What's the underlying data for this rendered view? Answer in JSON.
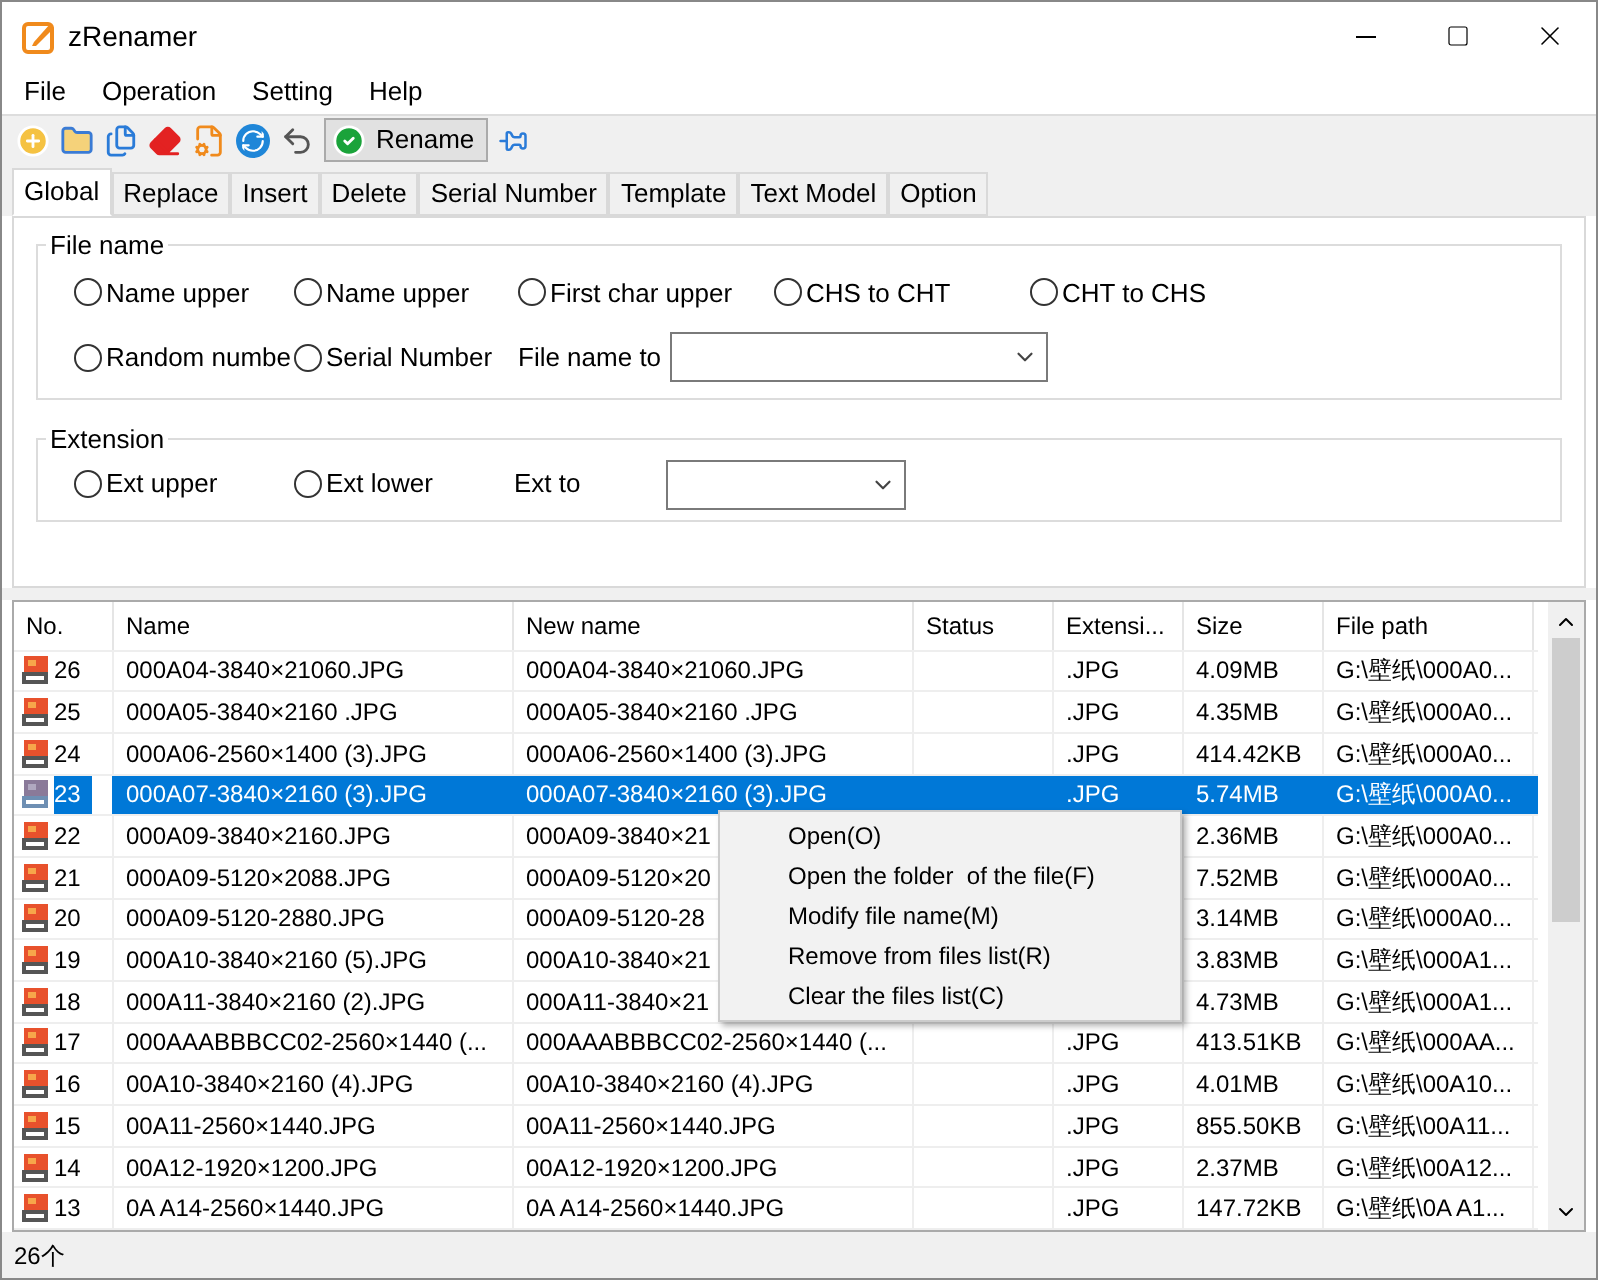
{
  "window": {
    "title": "zRenamer"
  },
  "menu": [
    "File",
    "Operation",
    "Setting",
    "Help"
  ],
  "toolbar": {
    "rename_button": "Rename"
  },
  "tabs": [
    {
      "label": "Global",
      "selected": true
    },
    {
      "label": "Replace",
      "selected": false
    },
    {
      "label": "Insert",
      "selected": false
    },
    {
      "label": "Delete",
      "selected": false
    },
    {
      "label": "Serial Number",
      "selected": false
    },
    {
      "label": "Template",
      "selected": false
    },
    {
      "label": "Text Model",
      "selected": false
    },
    {
      "label": "Option",
      "selected": false
    }
  ],
  "file_name_group": {
    "title": "File name",
    "options": [
      {
        "label": "Name upper",
        "selected": false
      },
      {
        "label": "Name upper",
        "selected": false
      },
      {
        "label": "First char upper",
        "selected": false
      },
      {
        "label": "CHS to CHT",
        "selected": false
      },
      {
        "label": "CHT to CHS",
        "selected": false
      },
      {
        "label": "Random numbe",
        "selected": false
      },
      {
        "label": "Serial Number",
        "selected": false
      }
    ],
    "field_label": "File name to"
  },
  "extension_group": {
    "title": "Extension",
    "options": [
      {
        "label": "Ext upper",
        "selected": false
      },
      {
        "label": "Ext lower",
        "selected": false
      }
    ],
    "field_label": "Ext to"
  },
  "table": {
    "columns": [
      "No.",
      "Name",
      "New name",
      "Status",
      "Extensi...",
      "Size",
      "File path"
    ],
    "rows": [
      {
        "no": "26",
        "name": "000A04-3840×21060.JPG",
        "new_name": "000A04-3840×21060.JPG",
        "extension": ".JPG",
        "size": "4.09MB",
        "path": "G:\\壁纸\\000A0...",
        "selected": false
      },
      {
        "no": "25",
        "name": "000A05-3840×2160 .JPG",
        "new_name": "000A05-3840×2160 .JPG",
        "extension": ".JPG",
        "size": "4.35MB",
        "path": "G:\\壁纸\\000A0...",
        "selected": false
      },
      {
        "no": "24",
        "name": "000A06-2560×1400 (3).JPG",
        "new_name": "000A06-2560×1400 (3).JPG",
        "extension": ".JPG",
        "size": "414.42KB",
        "path": "G:\\壁纸\\000A0...",
        "selected": false
      },
      {
        "no": "23",
        "name": "000A07-3840×2160 (3).JPG",
        "new_name": "000A07-3840×2160 (3).JPG",
        "extension": ".JPG",
        "size": "5.74MB",
        "path": "G:\\壁纸\\000A0...",
        "selected": true
      },
      {
        "no": "22",
        "name": "000A09-3840×2160.JPG",
        "new_name": "000A09-3840×21",
        "size": "2.36MB",
        "path": "G:\\壁纸\\000A0...",
        "selected": false
      },
      {
        "no": "21",
        "name": "000A09-5120×2088.JPG",
        "new_name": "000A09-5120×20",
        "size": "7.52MB",
        "path": "G:\\壁纸\\000A0...",
        "selected": false
      },
      {
        "no": "20",
        "name": "000A09-5120-2880.JPG",
        "new_name": "000A09-5120-28",
        "size": "3.14MB",
        "path": "G:\\壁纸\\000A0...",
        "selected": false
      },
      {
        "no": "19",
        "name": "000A10-3840×2160 (5).JPG",
        "new_name": "000A10-3840×21",
        "size": "3.83MB",
        "path": "G:\\壁纸\\000A1...",
        "selected": false
      },
      {
        "no": "18",
        "name": "000A11-3840×2160 (2).JPG",
        "new_name": "000A11-3840×21",
        "size": "4.73MB",
        "path": "G:\\壁纸\\000A1...",
        "selected": false
      },
      {
        "no": "17",
        "name": "000AAABBBCC02-2560×1440 (...",
        "new_name": "000AAABBBCC02-2560×1440 (...",
        "extension": ".JPG",
        "size": "413.51KB",
        "path": "G:\\壁纸\\000AA...",
        "selected": false
      },
      {
        "no": "16",
        "name": "00A10-3840×2160 (4).JPG",
        "new_name": "00A10-3840×2160 (4).JPG",
        "extension": ".JPG",
        "size": "4.01MB",
        "path": "G:\\壁纸\\00A10...",
        "selected": false
      },
      {
        "no": "15",
        "name": "00A11-2560×1440.JPG",
        "new_name": "00A11-2560×1440.JPG",
        "extension": ".JPG",
        "size": "855.50KB",
        "path": "G:\\壁纸\\00A11...",
        "selected": false
      },
      {
        "no": "14",
        "name": "00A12-1920×1200.JPG",
        "new_name": "00A12-1920×1200.JPG",
        "extension": ".JPG",
        "size": "2.37MB",
        "path": "G:\\壁纸\\00A12...",
        "selected": false
      },
      {
        "no": "13",
        "name": "0A A14-2560×1440.JPG",
        "new_name": "0A A14-2560×1440.JPG",
        "extension": ".JPG",
        "size": "147.72KB",
        "path": "G:\\壁纸\\0A A1...",
        "selected": false
      }
    ]
  },
  "context_menu": [
    "Open(O)",
    "Open the folder  of the file(F)",
    "Modify file name(M)",
    "Remove from files list(R)",
    "Clear the files list(C)"
  ],
  "status_bar": "26个"
}
